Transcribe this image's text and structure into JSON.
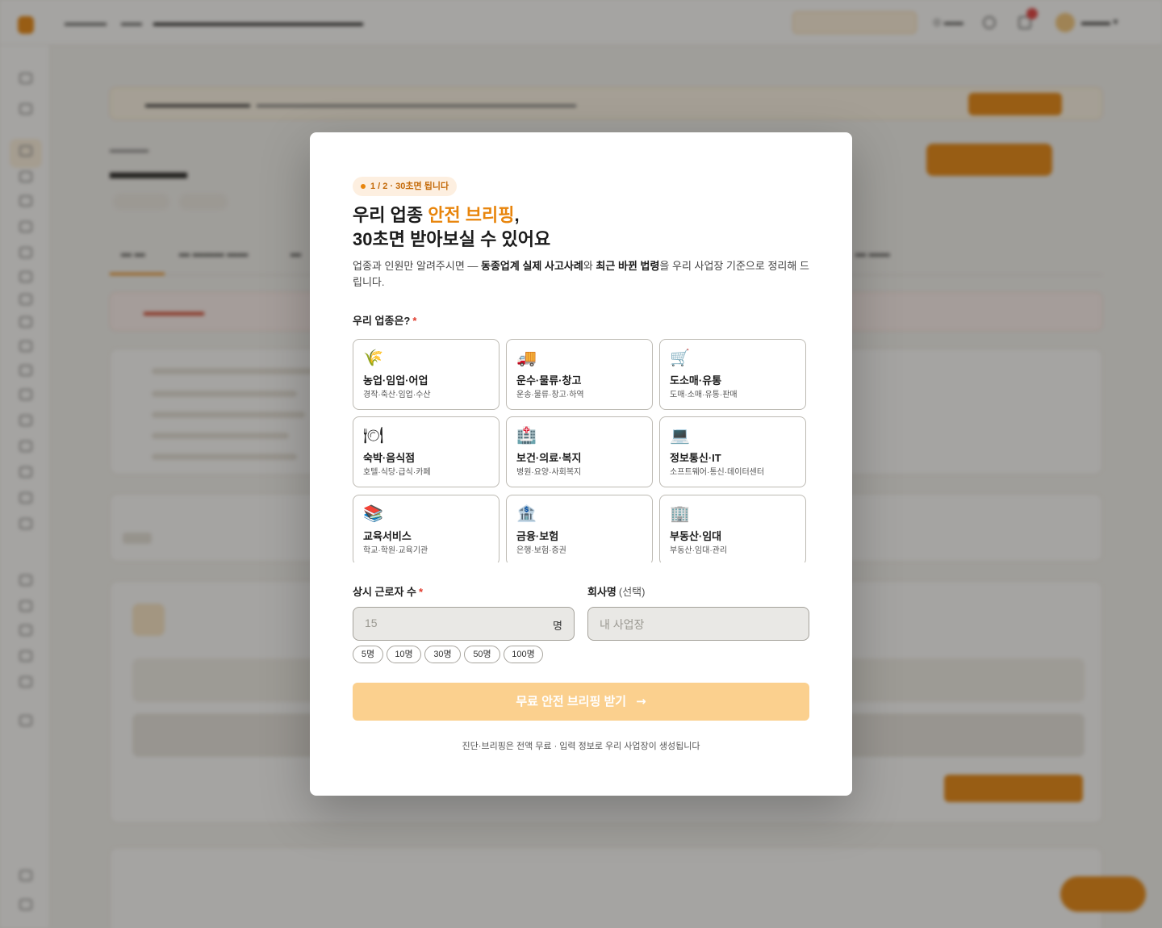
{
  "modal": {
    "step_badge": "1 / 2 · 30초면 됩니다",
    "heading_pre": "우리 업종 ",
    "heading_accent": "안전 브리핑",
    "heading_comma": ",",
    "heading_line2": "30초면 받아보실 수 있어요",
    "desc_1": "업종과 인원만 알려주시면 — ",
    "desc_bold_1": "동종업계 실제 사고사례",
    "desc_2": "와 ",
    "desc_bold_2": "최근 바뀐 법령",
    "desc_3": "을 우리 사업장 기준으로 정리해 드립니다.",
    "industry_label": "우리 업종은?",
    "required_mark": "*",
    "industries": [
      {
        "icon": "🌾",
        "icon_name": "wheat-icon",
        "name": "농업·임업·어업",
        "sub": "경작·축산·임업·수산"
      },
      {
        "icon": "🚚",
        "icon_name": "truck-icon",
        "name": "운수·물류·창고",
        "sub": "운송·물류·창고·하역"
      },
      {
        "icon": "🛒",
        "icon_name": "cart-icon",
        "name": "도소매·유통",
        "sub": "도매·소매·유통·판매"
      },
      {
        "icon": "🍽",
        "icon_name": "plate-icon",
        "name": "숙박·음식점",
        "sub": "호텔·식당·급식·카페"
      },
      {
        "icon": "🏥",
        "icon_name": "hospital-icon",
        "name": "보건·의료·복지",
        "sub": "병원·요양·사회복지"
      },
      {
        "icon": "💻",
        "icon_name": "laptop-icon",
        "name": "정보통신·IT",
        "sub": "소프트웨어·통신·데이터센터"
      },
      {
        "icon": "📚",
        "icon_name": "books-icon",
        "name": "교육서비스",
        "sub": "학교·학원·교육기관"
      },
      {
        "icon": "🏦",
        "icon_name": "bank-icon",
        "name": "금융·보험",
        "sub": "은행·보험·증권"
      },
      {
        "icon": "🏢",
        "icon_name": "office-icon",
        "name": "부동산·임대",
        "sub": "부동산·임대·관리"
      }
    ],
    "workers_label": "상시 근로자 수",
    "workers_placeholder": "15",
    "workers_unit": "명",
    "company_label": "회사명",
    "company_optional": "(선택)",
    "company_placeholder": "내 사업장",
    "worker_chips": [
      "5명",
      "10명",
      "30명",
      "50명",
      "100명"
    ],
    "submit_label": "무료 안전 브리핑 받기",
    "submit_arrow": "→",
    "footnote": "진단·브리핑은 전액 무료 · 입력 정보로 우리 사업장이 생성됩니다"
  },
  "colors": {
    "accent": "#e8850c",
    "overlay": "rgba(40,38,34,0.42)",
    "submit_disabled": "#fbd08e"
  }
}
